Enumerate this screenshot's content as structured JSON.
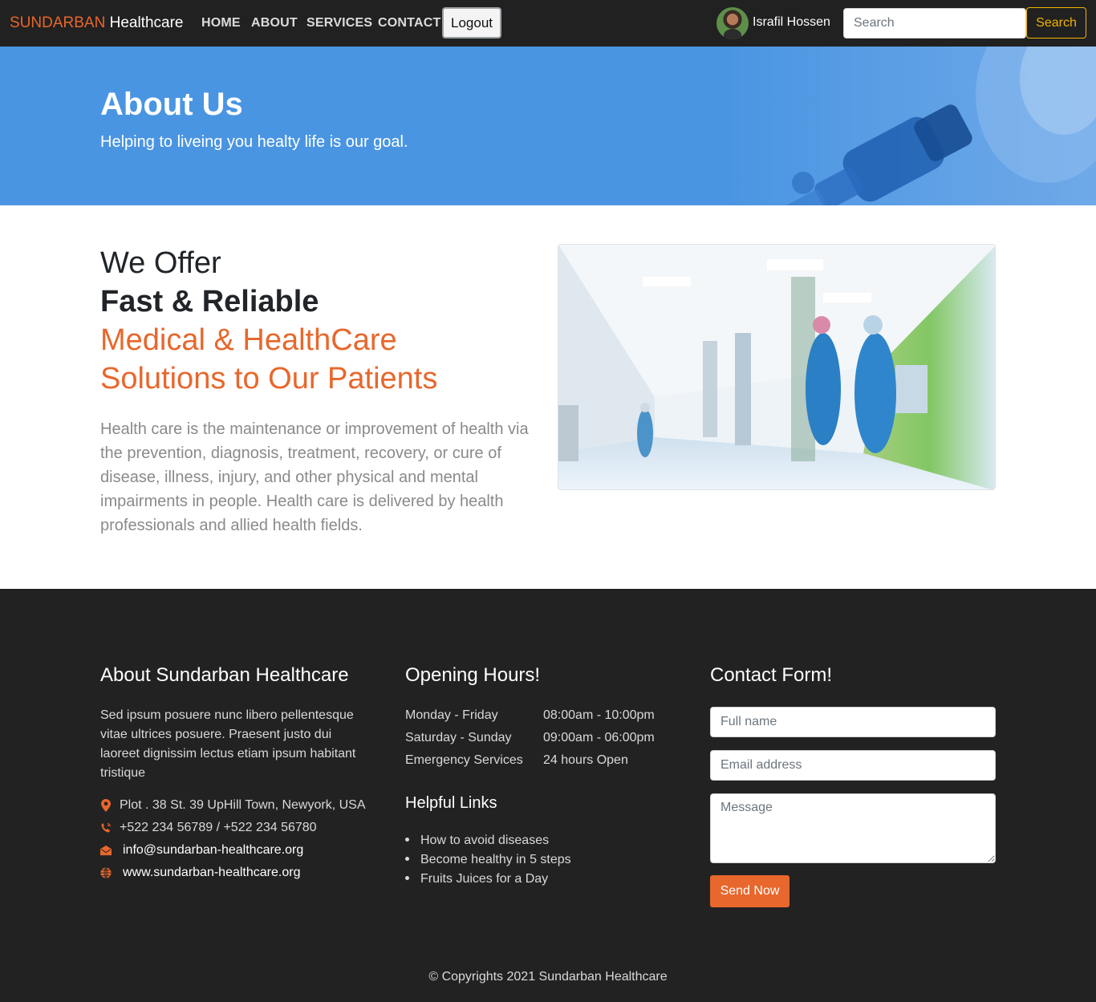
{
  "navbar": {
    "brand_part1": "SUNDARBAN",
    "brand_part2": "Healthcare",
    "links": [
      "HOME",
      "ABOUT",
      "SERVICES",
      "CONTACT"
    ],
    "logout_label": "Logout",
    "user_name": "Israfil Hossen",
    "search_placeholder": "Search",
    "search_button": "Search"
  },
  "hero": {
    "title": "About Us",
    "subtitle": "Helping to liveing you healty life is our goal."
  },
  "offer": {
    "line1": "We Offer",
    "line2": "Fast & Reliable",
    "line3": "Medical & HealthCare",
    "line4": "Solutions to Our Patients",
    "description": "Health care is the maintenance or improvement of health via the prevention, diagnosis, treatment, recovery, or cure of disease, illness, injury, and other physical and mental impairments in people. Health care is delivered by health professionals and allied health fields."
  },
  "footer": {
    "about": {
      "heading": "About Sundarban Healthcare",
      "text": "Sed ipsum posuere nunc libero pellentesque vitae ultrices posuere. Praesent justo dui laoreet dignissim lectus etiam ipsum habitant tristique",
      "address": "Plot . 38 St. 39 UpHill Town, Newyork, USA",
      "phone": "+522 234 56789 / +522 234 56780",
      "email": "info@sundarban-healthcare.org",
      "website": "www.sundarban-healthcare.org"
    },
    "hours": {
      "heading": "Opening Hours!",
      "rows": [
        {
          "day": "Monday - Friday",
          "time": "08:00am - 10:00pm"
        },
        {
          "day": "Saturday - Sunday",
          "time": "09:00am - 06:00pm"
        },
        {
          "day": "Emergency Services",
          "time": "24 hours Open"
        }
      ]
    },
    "links": {
      "heading": "Helpful Links",
      "items": [
        "How to avoid diseases",
        "Become healthy in 5 steps",
        "Fruits Juices for a Day"
      ]
    },
    "contact": {
      "heading": "Contact Form!",
      "name_placeholder": "Full name",
      "email_placeholder": "Email address",
      "message_placeholder": "Message",
      "send_label": "Send Now"
    },
    "copyright": "© Copyrights 2021 Sundarban Healthcare"
  },
  "colors": {
    "accent": "#e8672c",
    "navbar_bg": "#212121",
    "hero_bg": "#4a95e2",
    "footer_bg": "#222222",
    "search_button": "#f0b400"
  },
  "icons": {
    "address": "map-pin-icon",
    "phone": "phone-icon",
    "email": "envelope-icon",
    "website": "globe-icon"
  }
}
